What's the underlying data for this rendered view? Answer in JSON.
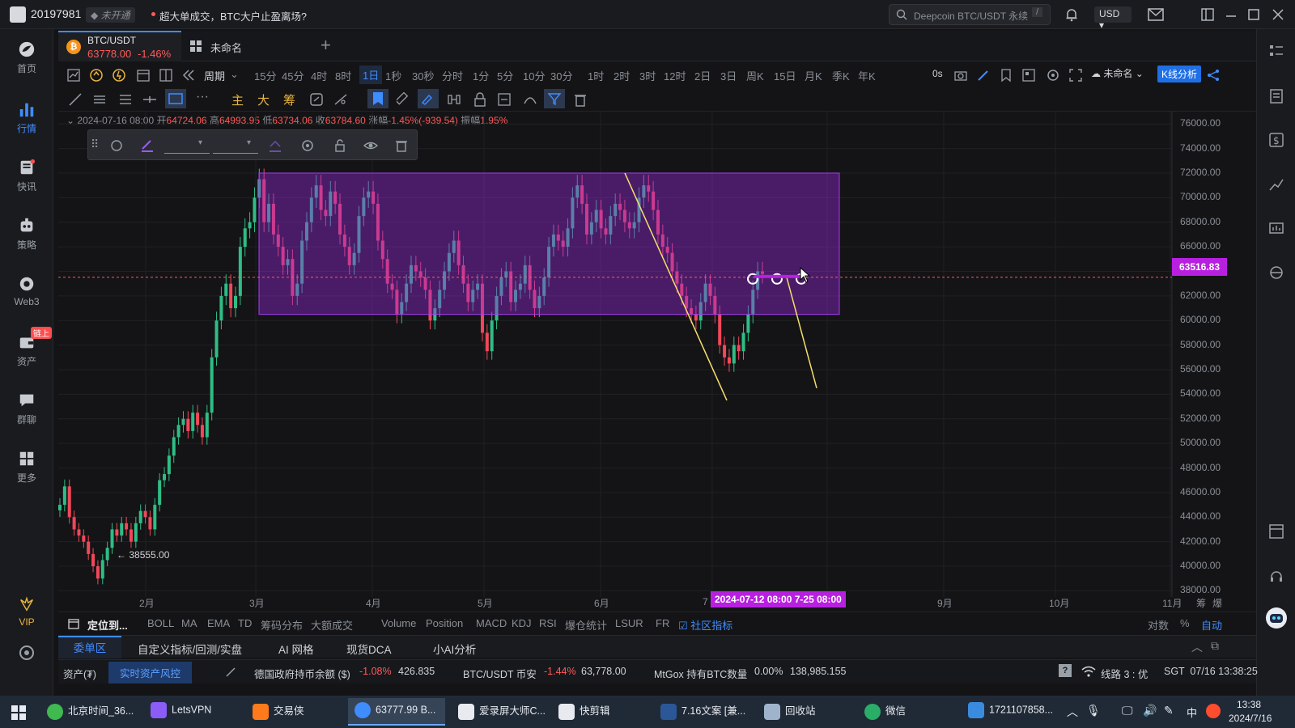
{
  "titlebar": {
    "user_id": "20197981",
    "verify_badge": "未开通",
    "news": "超大单成交，BTC大户止盈离场?",
    "search_placeholder": "Deepcoin BTC/USDT 永续",
    "search_shortcut": "/",
    "currency": "USD"
  },
  "sidebar": {
    "items": [
      {
        "label": "首页",
        "icon": "home-icon"
      },
      {
        "label": "行情",
        "icon": "market-icon"
      },
      {
        "label": "快讯",
        "icon": "news-icon"
      },
      {
        "label": "策略",
        "icon": "strategy-icon"
      },
      {
        "label": "Web3",
        "icon": "web3-icon"
      },
      {
        "label": "资产",
        "icon": "asset-icon",
        "badge": "链上"
      },
      {
        "label": "群聊",
        "icon": "chat-icon"
      },
      {
        "label": "更多",
        "icon": "more-icon"
      }
    ],
    "vip_label": "VIP"
  },
  "tabs": [
    {
      "pair": "BTC/USDT",
      "price": "63778.00",
      "change": "-1.46%"
    },
    {
      "pair": "未命名"
    }
  ],
  "timeframes": [
    "周期",
    "15分",
    "45分",
    "4时",
    "8时",
    "1日",
    "1秒",
    "30秒",
    "分时",
    "1分",
    "5分",
    "10分",
    "30分",
    "1时",
    "2时",
    "3时",
    "12时",
    "2日",
    "3日",
    "周K",
    "15日",
    "月K",
    "季K",
    "年K"
  ],
  "active_timeframe": "1日",
  "toolbar_right": {
    "latency": "0s",
    "layout_name": "未命名",
    "analysis_button": "K线分析"
  },
  "draw_tools": [
    "主",
    "大",
    "筹"
  ],
  "ohlc": {
    "date": "2024-07-16 08:00",
    "open_label": "开",
    "open": "64724.06",
    "high_label": "高",
    "high": "64993.95",
    "low_label": "低",
    "low": "63734.06",
    "close_label": "收",
    "close": "63784.60",
    "change_label": "涨幅",
    "change": "-1.45%(-939.54)",
    "amp_label": "振幅",
    "amp": "1.95%"
  },
  "price_axis": [
    "76000.00",
    "74000.00",
    "72000.00",
    "70000.00",
    "68000.00",
    "66000.00",
    "64000.00",
    "62000.00",
    "60000.00",
    "58000.00",
    "56000.00",
    "54000.00",
    "52000.00",
    "50000.00",
    "48000.00",
    "46000.00",
    "44000.00",
    "42000.00",
    "40000.00",
    "38000.00"
  ],
  "current_price_tag": "63516.83",
  "low_marker": "38555.00",
  "time_axis": [
    "2月",
    "3月",
    "4月",
    "5月",
    "6月",
    "7",
    "9月",
    "10月",
    "11月"
  ],
  "selected_range_label": "2024-07-12 08:00  7-25 08:00",
  "axis_right_labels": [
    "筹",
    "爆"
  ],
  "indicators": {
    "locate": "定位到...",
    "main": [
      "BOLL",
      "MA",
      "EMA",
      "TD",
      "筹码分布",
      "大额成交"
    ],
    "sub": [
      "Volume",
      "Position",
      "MACD",
      "KDJ",
      "RSI",
      "爆仓统计",
      "LSUR",
      "FR"
    ],
    "community": "社区指标",
    "right": [
      "对数",
      "%",
      "自动"
    ]
  },
  "bottom_tabs": [
    "委单区",
    "自定义指标/回测/实盘",
    "AI 网格",
    "现货DCA",
    "小AI分析"
  ],
  "ticker": {
    "asset_label": "资产(₮)",
    "risk_label": "实时资产风控",
    "items": [
      {
        "name": "德国政府持币余额 ($)",
        "change": "-1.08%",
        "value": "426.835"
      },
      {
        "name": "BTC/USDT 币安",
        "change": "-1.44%",
        "value": "63,778.00"
      },
      {
        "name": "MtGox 持有BTC数量",
        "change": "0.00%",
        "value": "138,985.155"
      }
    ],
    "line_status": "线路 3 : 优",
    "clock": "SGT  07/16 13:38:25"
  },
  "taskbar": {
    "apps": [
      "北京时间_36...",
      "LetsVPN",
      "交易侠",
      "63777.99 B...",
      "爱录屏大师C...",
      "快剪辑",
      "7.16文案 [兼...",
      "回收站",
      "微信",
      "1721107858..."
    ],
    "time": "13:38",
    "date": "2024/7/16",
    "ime": "中"
  },
  "chart_data": {
    "type": "candlestick",
    "pair": "BTC/USDT",
    "interval": "1日",
    "ylim": [
      37500,
      77000
    ],
    "x_labels": [
      "2月",
      "3月",
      "4月",
      "5月",
      "6月",
      "7",
      "9月",
      "10月",
      "11月"
    ],
    "current_price": 63516.83,
    "low_annotation": 38555.0,
    "rectangle": {
      "price_top": 72000,
      "price_bottom": 60500,
      "from": "3月",
      "to": "7"
    },
    "trend_lines": [
      {
        "from_price": 72000,
        "to_price": 53500
      },
      {
        "from_price": 63500,
        "to_price": 54500
      }
    ],
    "series_closes": [
      45000,
      46500,
      44000,
      43000,
      42500,
      42000,
      41000,
      40000,
      39000,
      40500,
      41500,
      43000,
      42500,
      43500,
      43000,
      42000,
      43500,
      44500,
      44000,
      43000,
      45000,
      47000,
      47500,
      49000,
      50500,
      51500,
      52000,
      51000,
      52500,
      51500,
      50500,
      52500,
      57000,
      60000,
      62000,
      63000,
      61000,
      62000,
      66000,
      67500,
      68000,
      70000,
      71500,
      68000,
      69500,
      67000,
      66000,
      64500,
      65000,
      62000,
      63000,
      66500,
      68000,
      70000,
      71000,
      69000,
      68500,
      70500,
      69500,
      67000,
      66000,
      64500,
      65500,
      68500,
      70000,
      70500,
      69500,
      66500,
      65000,
      63000,
      62500,
      60500,
      61500,
      63000,
      64500,
      64000,
      63500,
      62500,
      60000,
      61000,
      62500,
      64000,
      65500,
      66500,
      64500,
      63000,
      61500,
      62500,
      63000,
      59000,
      57500,
      60000,
      62000,
      63500,
      64000,
      61500,
      62500,
      63000,
      64500,
      62500,
      61000,
      62000,
      63500,
      66000,
      67000,
      66500,
      66000,
      67500,
      70000,
      71000,
      69500,
      67000,
      68000,
      69000,
      67500,
      67000,
      68500,
      69500,
      69000,
      68000,
      67500,
      68000,
      70000,
      71000,
      70500,
      69000,
      67000,
      66000,
      65500,
      64000,
      63000,
      62000,
      61000,
      60500,
      60000,
      61500,
      63000,
      62000,
      60500,
      58000,
      57000,
      56500,
      58000,
      57500,
      59000,
      60500,
      62500,
      64000,
      63778
    ]
  }
}
